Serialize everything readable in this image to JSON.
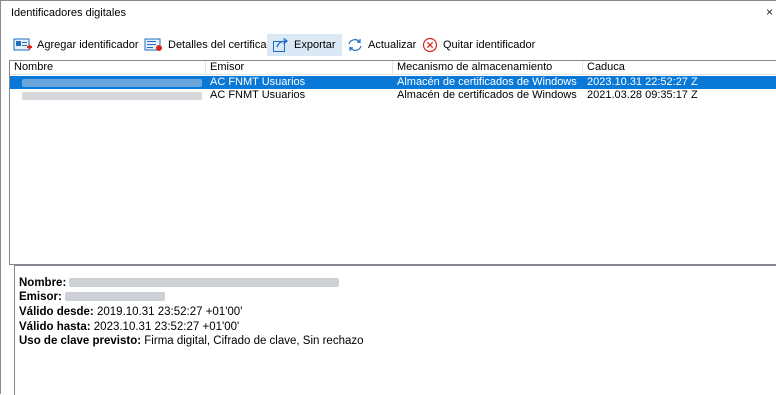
{
  "window": {
    "title": "Identificadores digitales",
    "close_glyph": "×"
  },
  "toolbar": {
    "add_label": "Agregar identificador",
    "details_label": "Detalles del certificado",
    "export_label": "Exportar",
    "refresh_label": "Actualizar",
    "remove_label": "Quitar identificador",
    "active_item": "export",
    "icons": {
      "add": "add-id-card-icon",
      "details": "certificate-details-icon",
      "export": "export-arrow-icon",
      "refresh": "refresh-icon",
      "remove": "remove-x-circle-icon"
    }
  },
  "list": {
    "columns": [
      "Nombre",
      "Emisor",
      "Mecanismo de almacenamiento",
      "Caduca"
    ],
    "rows": [
      {
        "emisor": "AC FNMT Usuarios",
        "mecanismo": "Almacén de certificados de Windows",
        "caduca": "2023.10.31 22:52:27 Z",
        "selected": true
      },
      {
        "emisor": "AC FNMT Usuarios",
        "mecanismo": "Almacén de certificados de Windows",
        "caduca": "2021.03.28 09:35:17 Z",
        "selected": false
      }
    ]
  },
  "detail": {
    "nombre_label": "Nombre:",
    "emisor_label": "Emisor:",
    "valido_desde_label": "Válido desde:",
    "valido_desde_value": "2019.10.31 23:52:27 +01'00'",
    "valido_hasta_label": "Válido hasta:",
    "valido_hasta_value": "2023.10.31 23:52:27 +01'00'",
    "uso_label": "Uso de clave previsto:",
    "uso_value": "Firma digital, Cifrado de clave, Sin rechazo"
  },
  "colors": {
    "selection": "#0a78d7",
    "toolbar_active": "#dbe9f7",
    "icon_blue": "#1e6fbf",
    "icon_red": "#d9251d",
    "redaction": "#cdd0d4"
  }
}
